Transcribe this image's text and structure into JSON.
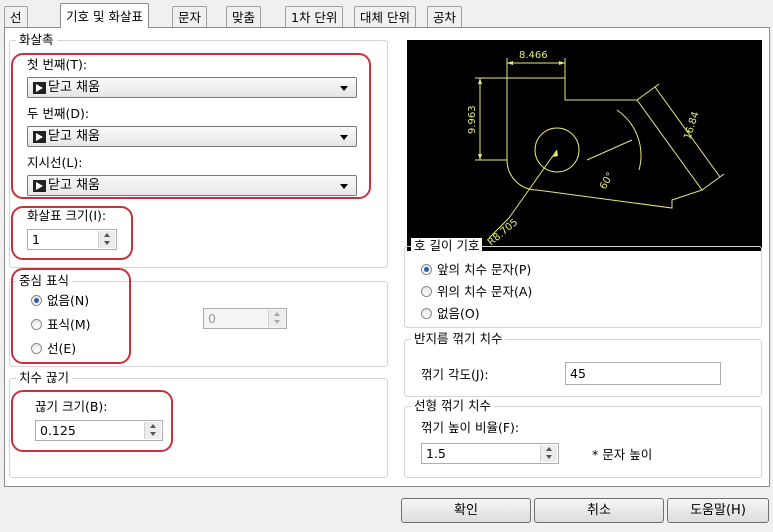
{
  "tabs": [
    {
      "label": "선"
    },
    {
      "label": "기호 및 화살표"
    },
    {
      "label": "문자"
    },
    {
      "label": "맞춤"
    },
    {
      "label": "1차 단위"
    },
    {
      "label": "대체 단위"
    },
    {
      "label": "공차"
    }
  ],
  "arrowheads": {
    "title": "화살촉",
    "first_label": "첫 번째(T):",
    "first_value": "닫고 채움",
    "second_label": "두 번째(D):",
    "second_value": "닫고 채움",
    "leader_label": "지시선(L):",
    "leader_value": "닫고 채움",
    "size_label": "화살표 크기(I):",
    "size_value": "1"
  },
  "center_marks": {
    "title": "중심 표식",
    "options": [
      "없음(N)",
      "표식(M)",
      "선(E)"
    ],
    "selected_index": 0,
    "size_value": "0"
  },
  "dim_break": {
    "title": "치수 끊기",
    "size_label": "끊기 크기(B):",
    "size_value": "0.125"
  },
  "preview": {
    "dims": [
      "8.466",
      "9.963",
      "16.84",
      "60°",
      "R8.705"
    ]
  },
  "arc_length": {
    "title": "호 길이 기호",
    "options": [
      "앞의 치수 문자(P)",
      "위의 치수 문자(A)",
      "없음(O)"
    ],
    "selected_index": 0
  },
  "radius_jog": {
    "title": "반지름 꺾기 치수",
    "angle_label": "꺾기 각도(J):",
    "angle_value": "45"
  },
  "linear_jog": {
    "title": "선형 꺾기 치수",
    "height_label": "꺾기 높이 비율(F):",
    "height_value": "1.5",
    "height_suffix": "* 문자 높이"
  },
  "buttons": {
    "ok": "확인",
    "cancel": "취소",
    "help": "도움말(H)"
  },
  "colors": {
    "highlight": "#c8323c",
    "preview_line": "#e8e87a",
    "radio_dot": "#2a5db8"
  }
}
